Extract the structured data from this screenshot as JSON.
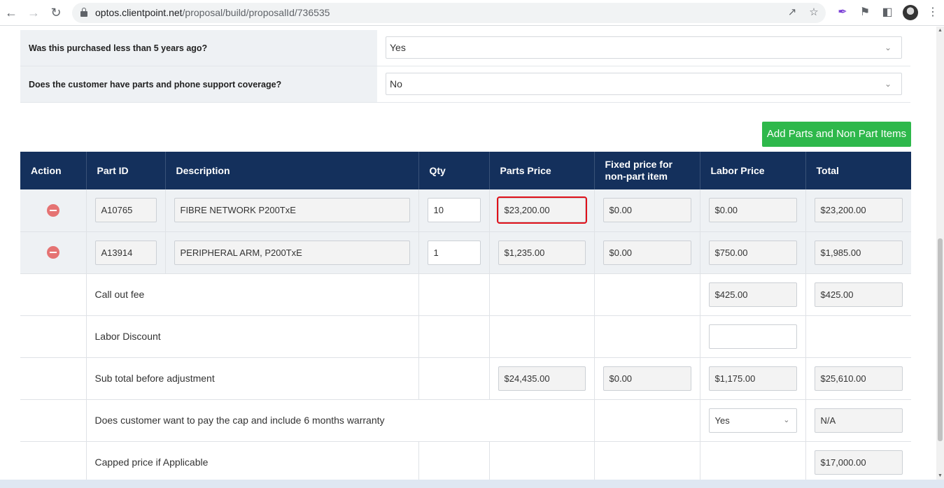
{
  "browser": {
    "url_domain": "optos.clientpoint.net",
    "url_path": "/proposal/build/proposalId/736535"
  },
  "questions": [
    {
      "label": "Was this purchased less than 5 years ago?",
      "value": "Yes"
    },
    {
      "label": "Does the customer have parts and phone support coverage?",
      "value": "No"
    }
  ],
  "add_button_label": "Add Parts and Non Part Items",
  "table": {
    "headers": {
      "action": "Action",
      "part_id": "Part ID",
      "description": "Description",
      "qty": "Qty",
      "parts_price": "Parts Price",
      "fixed_price_line1": "Fixed price for",
      "fixed_price_line2": "non-part item",
      "labor_price": "Labor Price",
      "total": "Total"
    },
    "items": [
      {
        "part_id": "A10765",
        "description": "FIBRE NETWORK P200TxE",
        "qty": "10",
        "parts_price": "$23,200.00",
        "fixed_price": "$0.00",
        "labor_price": "$0.00",
        "total": "$23,200.00"
      },
      {
        "part_id": "A13914",
        "description": "PERIPHERAL ARM, P200TxE",
        "qty": "1",
        "parts_price": "$1,235.00",
        "fixed_price": "$0.00",
        "labor_price": "$750.00",
        "total": "$1,985.00"
      }
    ],
    "summary": {
      "call_out_fee": {
        "label": "Call out fee",
        "labor": "$425.00",
        "total": "$425.00"
      },
      "labor_discount": {
        "label": "Labor Discount",
        "labor": ""
      },
      "subtotal": {
        "label": "Sub total before adjustment",
        "parts": "$24,435.00",
        "fixed": "$0.00",
        "labor": "$1,175.00",
        "total": "$25,610.00"
      },
      "cap_warranty": {
        "label": "Does customer want to pay the cap and include 6 months warranty",
        "select": "Yes",
        "total": "N/A"
      },
      "capped_price": {
        "label": "Capped price if Applicable",
        "total": "$17,000.00"
      }
    }
  },
  "colors": {
    "header_bg": "#14305c",
    "add_button": "#2eb84b",
    "highlight": "#e0101a",
    "remove_icon": "#e57373"
  }
}
